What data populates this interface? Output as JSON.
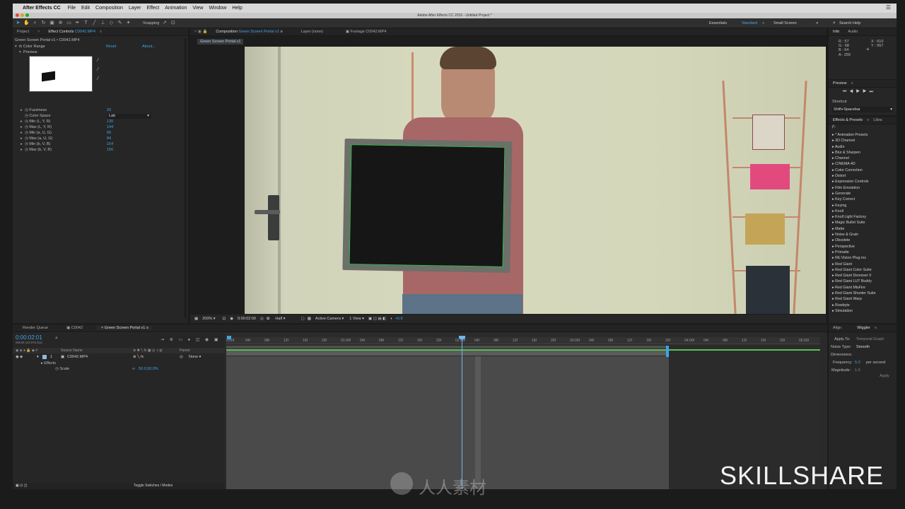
{
  "menubar": {
    "app": "After Effects CC",
    "items": [
      "File",
      "Edit",
      "Composition",
      "Layer",
      "Effect",
      "Animation",
      "View",
      "Window",
      "Help"
    ]
  },
  "window_title": "Adobe After Effects CC 2015 - Untitled Project *",
  "toolbar": {
    "snapping": "Snapping",
    "workspaces": [
      "Essentials",
      "Standard",
      "Small Screen"
    ],
    "active_workspace": "Standard",
    "search_placeholder": "Search Help"
  },
  "left_panel": {
    "tabs": [
      "Project",
      "Effect Controls",
      "C0042.MP4"
    ],
    "breadcrumb": "Green Screen Portal v1 • C0042.MP4",
    "effect_name": "Color Range",
    "reset": "Reset",
    "about": "About...",
    "preview_label": "Preview",
    "params": [
      {
        "name": "Fuzziness",
        "value": "20"
      },
      {
        "name": "Color Space",
        "value": "Lab"
      },
      {
        "name": "Min (L, Y, R)",
        "value": "130"
      },
      {
        "name": "Max (L, Y, R)",
        "value": "144"
      },
      {
        "name": "Min (a, U, G)",
        "value": "80"
      },
      {
        "name": "Max (a, U, G)",
        "value": "84"
      },
      {
        "name": "Min (b, V, B)",
        "value": "154"
      },
      {
        "name": "Max (b, V, B)",
        "value": "156"
      }
    ]
  },
  "viewer": {
    "tabs": [
      "Composition",
      "Green Screen Portal v1",
      "Layer (none)",
      "Footage C0042.MP4"
    ],
    "comp_chip": "Green Screen Portal v1",
    "zoom": "200%",
    "timecode": "0:00:02:00",
    "resolution": "Half",
    "camera": "Active Camera",
    "views": "1 View",
    "exposure": "+0.0"
  },
  "info": {
    "tabs": [
      "Info",
      "Audio"
    ],
    "r": "R : 57",
    "g": "G : 68",
    "b": "B : 64",
    "a": "A : 255",
    "x": "X : 610",
    "y": "Y : 957"
  },
  "preview": {
    "title": "Preview",
    "shortcut_label": "Shortcut",
    "shortcut_value": "Shift+Spacebar"
  },
  "effects_presets": {
    "tabs": [
      "Effects & Presets",
      "Libra"
    ],
    "search": "ρ.",
    "items": [
      "* Animation Presets",
      "3D Channel",
      "Audio",
      "Blur & Sharpen",
      "Channel",
      "CINEMA 4D",
      "Color Correction",
      "Distort",
      "Expression Controls",
      "Film Emulation",
      "Generate",
      "Key Correct",
      "Keying",
      "Knoll",
      "Knoll Light Factory",
      "Magic Bullet Suite",
      "Matte",
      "Noise & Grain",
      "Obsolete",
      "Perspective",
      "Primatte",
      "RE:Vision Plug-ins",
      "Red Giant",
      "Red Giant Color Suite",
      "Red Giant Denoiser II",
      "Red Giant LUT Buddy",
      "Red Giant MisFire",
      "Red Giant Shooter Suite",
      "Red Giant Warp",
      "Rowbyte",
      "Simulation"
    ]
  },
  "wiggler": {
    "tabs": [
      "Align",
      "Wiggler"
    ],
    "apply_to_label": "Apply To:",
    "apply_to": "Temporal Graph",
    "noise_label": "Noise Type:",
    "noise": "Smooth",
    "dimensions_label": "Dimensions:",
    "frequency_label": "Frequency:",
    "frequency": "5.0",
    "per_second": "per second",
    "magnitude_label": "Magnitude:",
    "magnitude": "1.0",
    "apply": "Apply"
  },
  "timeline": {
    "tabs": [
      "Render Queue",
      "C0042",
      "Green Screen Portal v1"
    ],
    "timecode": "0:00:02:01",
    "fps": "00049 (23.976 fps)",
    "col_source": "Source Name",
    "col_parent": "Parent",
    "layer_num": "1",
    "layer_name": "C0042.MP4",
    "parent": "None",
    "effects": "Effects",
    "scale_label": "Scale",
    "scale_value": "50.0,50.0%",
    "toggle": "Toggle Switches / Modes",
    "ruler": [
      "0:00f",
      "04f",
      "08f",
      "12f",
      "16f",
      "20f",
      "01:00f",
      "04f",
      "08f",
      "12f",
      "16f",
      "20f",
      "02:00f",
      "04f",
      "08f",
      "12f",
      "16f",
      "20f",
      "03:00f",
      "04f",
      "08f",
      "12f",
      "16f",
      "20f",
      "04:00f",
      "04f",
      "08f",
      "12f",
      "16f",
      "20f",
      "05:00f"
    ]
  },
  "watermark": {
    "brand": "SKILLSHARE",
    "site": "人人素材"
  },
  "colors": {
    "accent": "#3da6e8",
    "panel": "#262626",
    "timeline_bar": "#58c156"
  }
}
